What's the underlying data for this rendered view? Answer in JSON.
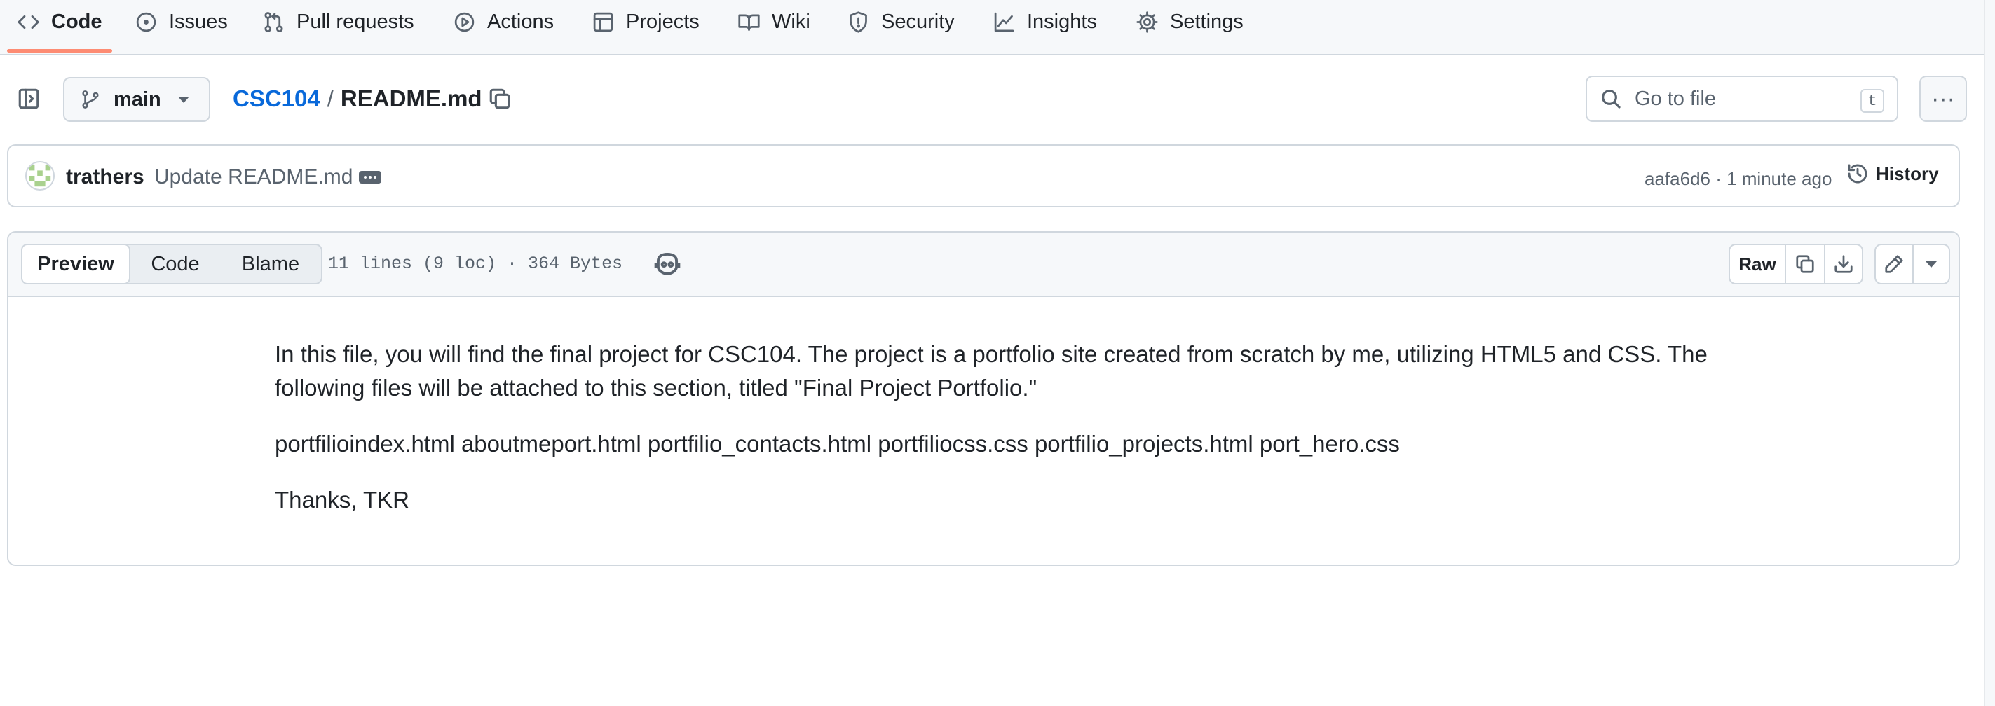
{
  "nav": {
    "items": [
      {
        "label": "Code",
        "icon": "code-icon",
        "active": true
      },
      {
        "label": "Issues",
        "icon": "issue-icon"
      },
      {
        "label": "Pull requests",
        "icon": "pull-request-icon"
      },
      {
        "label": "Actions",
        "icon": "play-icon"
      },
      {
        "label": "Projects",
        "icon": "table-icon"
      },
      {
        "label": "Wiki",
        "icon": "book-icon"
      },
      {
        "label": "Security",
        "icon": "shield-icon"
      },
      {
        "label": "Insights",
        "icon": "graph-icon"
      },
      {
        "label": "Settings",
        "icon": "gear-icon"
      }
    ]
  },
  "file_header": {
    "branch": "main",
    "repo": "CSC104",
    "separator": "/",
    "file": "README.md",
    "search_placeholder": "Go to file",
    "search_shortcut": "t",
    "more": "···"
  },
  "commit": {
    "author": "trathers",
    "message": "Update README.md",
    "meta": "aafa6d6 · 1 minute ago",
    "history_label": "History"
  },
  "file_toolbar": {
    "tabs": [
      "Preview",
      "Code",
      "Blame"
    ],
    "active_tab": "Preview",
    "stats": "11 lines (9 loc) · 364 Bytes",
    "raw_label": "Raw"
  },
  "readme": {
    "paragraphs": [
      "In this file, you will find the final project for CSC104. The project is a portfolio site created from scratch by me, utilizing HTML5 and CSS. The following files will be attached to this section, titled \"Final Project Portfolio.\"",
      "portfilioindex.html aboutmeport.html portfilio_contacts.html portfiliocss.css portfilio_projects.html port_hero.css",
      "Thanks, TKR"
    ]
  },
  "colors": {
    "accent_link": "#0969da",
    "nav_underline": "#fd8c73",
    "border": "#d0d7de",
    "muted_text": "#59636e"
  }
}
